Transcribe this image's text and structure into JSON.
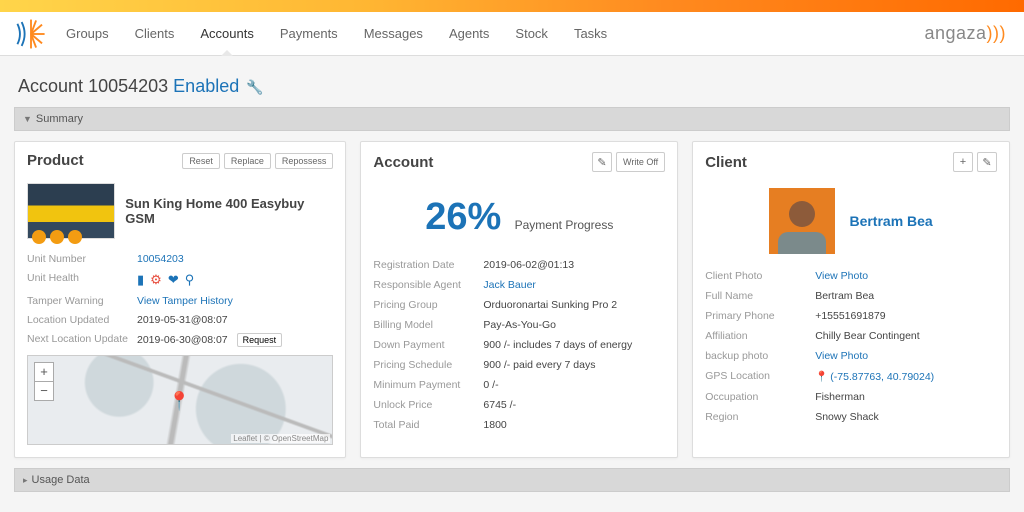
{
  "nav": {
    "items": [
      "Groups",
      "Clients",
      "Accounts",
      "Payments",
      "Messages",
      "Agents",
      "Stock",
      "Tasks"
    ],
    "active_index": 2
  },
  "brand": {
    "name": "angaza"
  },
  "page": {
    "title_prefix": "Account",
    "account_number": "10054203",
    "status": "Enabled"
  },
  "sections": {
    "summary_label": "Summary",
    "usage_label": "Usage Data"
  },
  "product": {
    "card_title": "Product",
    "buttons": {
      "reset": "Reset",
      "replace": "Replace",
      "repossess": "Repossess"
    },
    "name": "Sun King Home 400 Easybuy GSM",
    "fields": {
      "unit_number_label": "Unit Number",
      "unit_number": "10054203",
      "unit_health_label": "Unit Health",
      "tamper_label": "Tamper Warning",
      "tamper_link": "View Tamper History",
      "loc_updated_label": "Location Updated",
      "loc_updated": "2019-05-31@08:07",
      "next_loc_label": "Next Location Update",
      "next_loc": "2019-06-30@08:07",
      "request_btn": "Request"
    },
    "map": {
      "zoom_in": "+",
      "zoom_out": "−",
      "attribution": "Leaflet | © OpenStreetMap"
    }
  },
  "account": {
    "card_title": "Account",
    "writeoff_btn": "Write Off",
    "progress_pct": "26%",
    "progress_label": "Payment Progress",
    "fields": {
      "reg_date_label": "Registration Date",
      "reg_date": "2019-06-02@01:13",
      "agent_label": "Responsible Agent",
      "agent": "Jack Bauer",
      "group_label": "Pricing Group",
      "group": "Orduoronartai Sunking Pro 2",
      "billing_label": "Billing Model",
      "billing": "Pay-As-You-Go",
      "down_label": "Down Payment",
      "down": "900 /- includes 7 days of energy",
      "schedule_label": "Pricing Schedule",
      "schedule": "900 /- paid every 7 days",
      "min_label": "Minimum Payment",
      "min": "0 /-",
      "unlock_label": "Unlock Price",
      "unlock": "6745 /-",
      "total_label": "Total Paid",
      "total": "1800"
    }
  },
  "client": {
    "card_title": "Client",
    "name": "Bertram Bea",
    "fields": {
      "photo_label": "Client Photo",
      "photo_link": "View Photo",
      "fullname_label": "Full Name",
      "fullname": "Bertram Bea",
      "phone_label": "Primary Phone",
      "phone": "+15551691879",
      "affiliation_label": "Affiliation",
      "affiliation": "Chilly Bear Contingent",
      "backup_label": "backup photo",
      "backup_link": "View Photo",
      "gps_label": "GPS Location",
      "gps": "(-75.87763, 40.79024)",
      "occupation_label": "Occupation",
      "occupation": "Fisherman",
      "region_label": "Region",
      "region": "Snowy Shack"
    }
  }
}
